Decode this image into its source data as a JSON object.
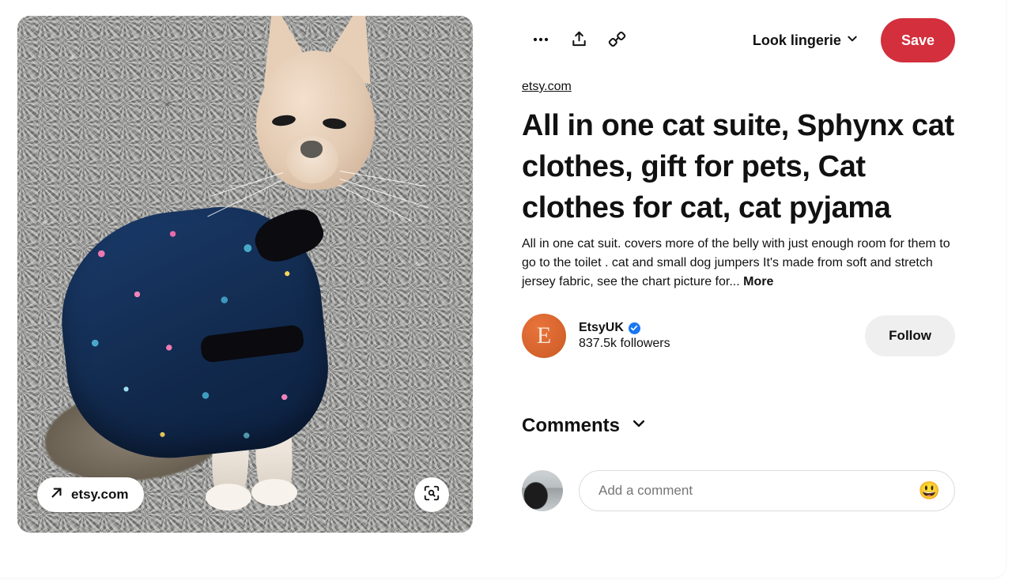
{
  "pin": {
    "source_domain": "etsy.com",
    "title": "All in one cat suite, Sphynx cat clothes, gift for pets, Cat clothes for cat, cat pyjama",
    "description": "All in one cat suit. covers more of the belly with just enough room for them to go to the toilet . cat and small dog jumpers It's made from soft and stretch jersey fabric, see the chart picture for...",
    "more_label": "More"
  },
  "actions": {
    "more_options_icon": "ellipsis-icon",
    "share_icon": "share-icon",
    "copy_link_icon": "link-icon",
    "board_name": "Look lingerie",
    "board_chevron_icon": "chevron-down-icon",
    "save_label": "Save",
    "save_color": "#d32f3c"
  },
  "media": {
    "overlay_link_label": "etsy.com",
    "overlay_link_icon": "arrow-up-right-icon",
    "visual_search_icon": "lens-search-icon",
    "alt": "Sphynx cat on grey carpet wearing a navy mermaid print all-in-one cat suit"
  },
  "creator": {
    "avatar_initial": "E",
    "avatar_color": "#d4622b",
    "name": "EtsyUK",
    "verified_icon": "verified-badge-icon",
    "followers": "837.5k followers",
    "follow_label": "Follow"
  },
  "comments": {
    "heading": "Comments",
    "chevron_icon": "chevron-down-icon",
    "input_placeholder": "Add a comment",
    "input_value": "",
    "emoji_icon": "grinning-face-icon",
    "emoji_glyph": "😃"
  }
}
